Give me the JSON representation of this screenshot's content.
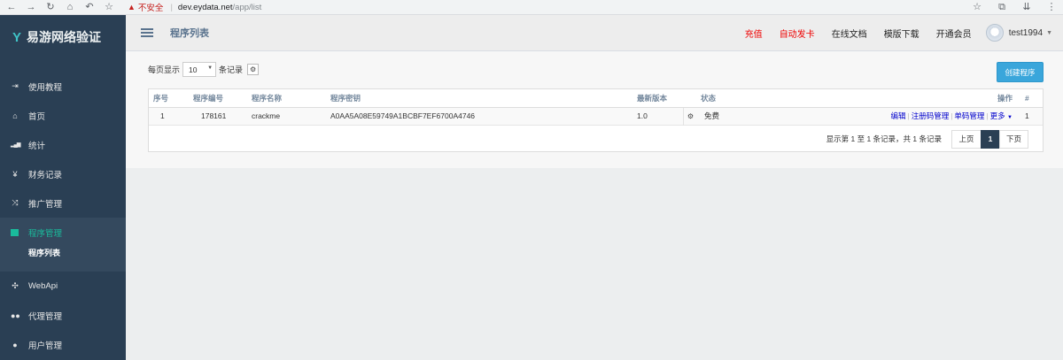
{
  "browser": {
    "warning_label": "不安全",
    "url_host": "dev.eydata.net",
    "url_path": "/app/list"
  },
  "sidebar": {
    "brand": "易游网络验证",
    "items": [
      {
        "label": "使用教程",
        "icon": "sign-in-icon",
        "glyph": "⇥"
      },
      {
        "label": "首页",
        "icon": "home-icon",
        "glyph": "⌂"
      },
      {
        "label": "统计",
        "icon": "bar-chart-icon",
        "glyph": "▁▃▅"
      },
      {
        "label": "财务记录",
        "icon": "yen-icon",
        "glyph": "¥"
      },
      {
        "label": "推广管理",
        "icon": "shuffle-icon",
        "glyph": "⤨"
      },
      {
        "label": "程序管理",
        "icon": "windows-icon",
        "glyph": "▇"
      },
      {
        "label": "WebApi",
        "icon": "joomla-icon",
        "glyph": "✣"
      },
      {
        "label": "代理管理",
        "icon": "users-icon",
        "glyph": "👥"
      },
      {
        "label": "用户管理",
        "icon": "user-icon",
        "glyph": "👤"
      }
    ],
    "submenu_active": "程序列表"
  },
  "header": {
    "title": "程序列表",
    "links": [
      "充值",
      "自动发卡",
      "在线文档",
      "模版下载",
      "开通会员"
    ],
    "user": "test1994"
  },
  "toolbar": {
    "per_page_prefix": "每页显示",
    "per_page_value": "10",
    "per_page_suffix": "条记录",
    "create_button": "创建程序"
  },
  "table": {
    "headers": [
      "序号",
      "程序编号",
      "程序名称",
      "程序密钥",
      "最新版本",
      "状态",
      "操作",
      "#"
    ],
    "rows": [
      {
        "idx": "1",
        "number": "178161",
        "name": "crackme",
        "key": "A0AA5A08E59749A1BCBF7EF6700A4746",
        "version": "1.0",
        "status": "免费",
        "ops": [
          "编辑",
          "注册码管理",
          "单码管理",
          "更多"
        ],
        "hash": "1"
      }
    ]
  },
  "pagination": {
    "info": "显示第 1 至 1 条记录，共 1 条记录",
    "prev": "上页",
    "current": "1",
    "next": "下页"
  }
}
